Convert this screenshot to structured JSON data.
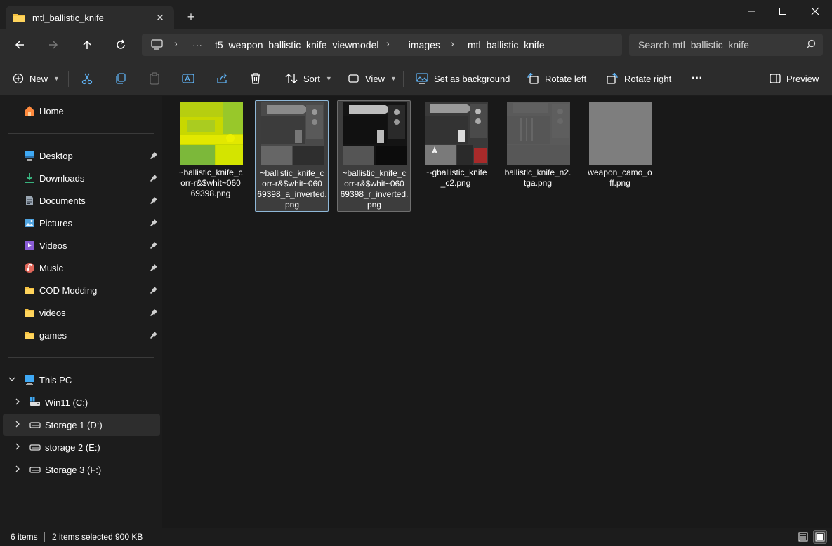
{
  "window": {
    "tab_title": "mtl_ballistic_knife",
    "new_tab_label": "+"
  },
  "address": {
    "ellipsis": "···",
    "crumbs": [
      "t5_weapon_ballistic_knife_viewmodel",
      "_images",
      "mtl_ballistic_knife"
    ],
    "search_placeholder": "Search mtl_ballistic_knife"
  },
  "commands": {
    "new": "New",
    "sort": "Sort",
    "view": "View",
    "set_background": "Set as background",
    "rotate_left": "Rotate left",
    "rotate_right": "Rotate right",
    "more": "···",
    "preview": "Preview"
  },
  "sidebar": {
    "home": "Home",
    "quick": [
      {
        "label": "Desktop",
        "icon": "desktop-icon",
        "color": "#3fa9f5"
      },
      {
        "label": "Downloads",
        "icon": "download-icon",
        "color": "#3cc48a"
      },
      {
        "label": "Documents",
        "icon": "document-icon",
        "color": "#9aa6b2"
      },
      {
        "label": "Pictures",
        "icon": "pictures-icon",
        "color": "#4fa3e0"
      },
      {
        "label": "Videos",
        "icon": "videos-icon",
        "color": "#8a5cd6"
      },
      {
        "label": "Music",
        "icon": "music-icon",
        "color": "#e0675b"
      },
      {
        "label": "COD Modding",
        "icon": "folder-icon",
        "color": "#f5c242"
      },
      {
        "label": "videos",
        "icon": "folder-icon",
        "color": "#f5c242"
      },
      {
        "label": "games",
        "icon": "folder-icon",
        "color": "#f5c242"
      }
    ],
    "this_pc": "This PC",
    "drives": [
      {
        "label": "Win11 (C:)"
      },
      {
        "label": "Storage 1 (D:)"
      },
      {
        "label": "storage 2 (E:)"
      },
      {
        "label": "Storage 3 (F:)"
      }
    ]
  },
  "files": [
    {
      "line1": "~ballistic_knife_c",
      "line2": "orr-r&$whit~060",
      "line3": "69398.png",
      "line4": "",
      "state": "normal",
      "thumb": "yellow"
    },
    {
      "line1": "~ballistic_knife_c",
      "line2": "orr-r&$whit~060",
      "line3": "69398_a_inverted.",
      "line4": "png",
      "state": "focus",
      "thumb": "gray"
    },
    {
      "line1": "~ballistic_knife_c",
      "line2": "orr-r&$whit~060",
      "line3": "69398_r_inverted.",
      "line4": "png",
      "state": "sel",
      "thumb": "dark"
    },
    {
      "line1": "~-gballistic_knife",
      "line2": "_c2.png",
      "line3": "",
      "line4": "",
      "state": "normal",
      "thumb": "color"
    },
    {
      "line1": "ballistic_knife_n2.",
      "line2": "tga.png",
      "line3": "",
      "line4": "",
      "state": "normal",
      "thumb": "normal"
    },
    {
      "line1": "weapon_camo_o",
      "line2": "ff.png",
      "line3": "",
      "line4": "",
      "state": "normal",
      "thumb": "flat"
    }
  ],
  "status": {
    "items": "6 items",
    "selected": "2 items selected",
    "size": "900 KB"
  }
}
